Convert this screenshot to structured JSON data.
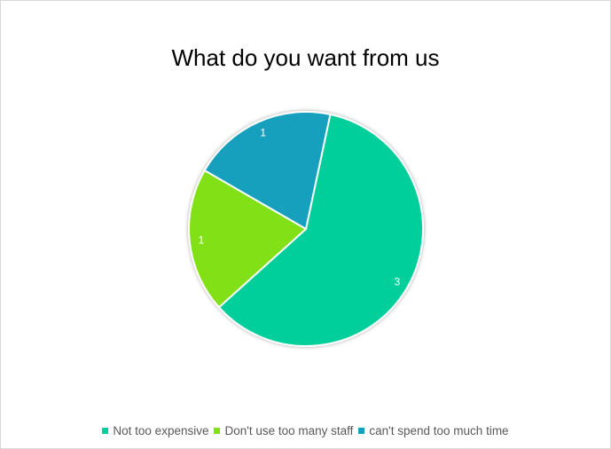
{
  "chart_data": {
    "type": "pie",
    "title": "What do you want from us",
    "categories": [
      "Not too expensive",
      "Don't use too many staff",
      "can't spend too much time"
    ],
    "values": [
      3,
      1,
      1
    ],
    "colors": [
      "#05cf9c",
      "#81e118",
      "#13a0be"
    ],
    "data_labels": [
      "3",
      "1",
      "1"
    ],
    "legend_position": "bottom"
  }
}
